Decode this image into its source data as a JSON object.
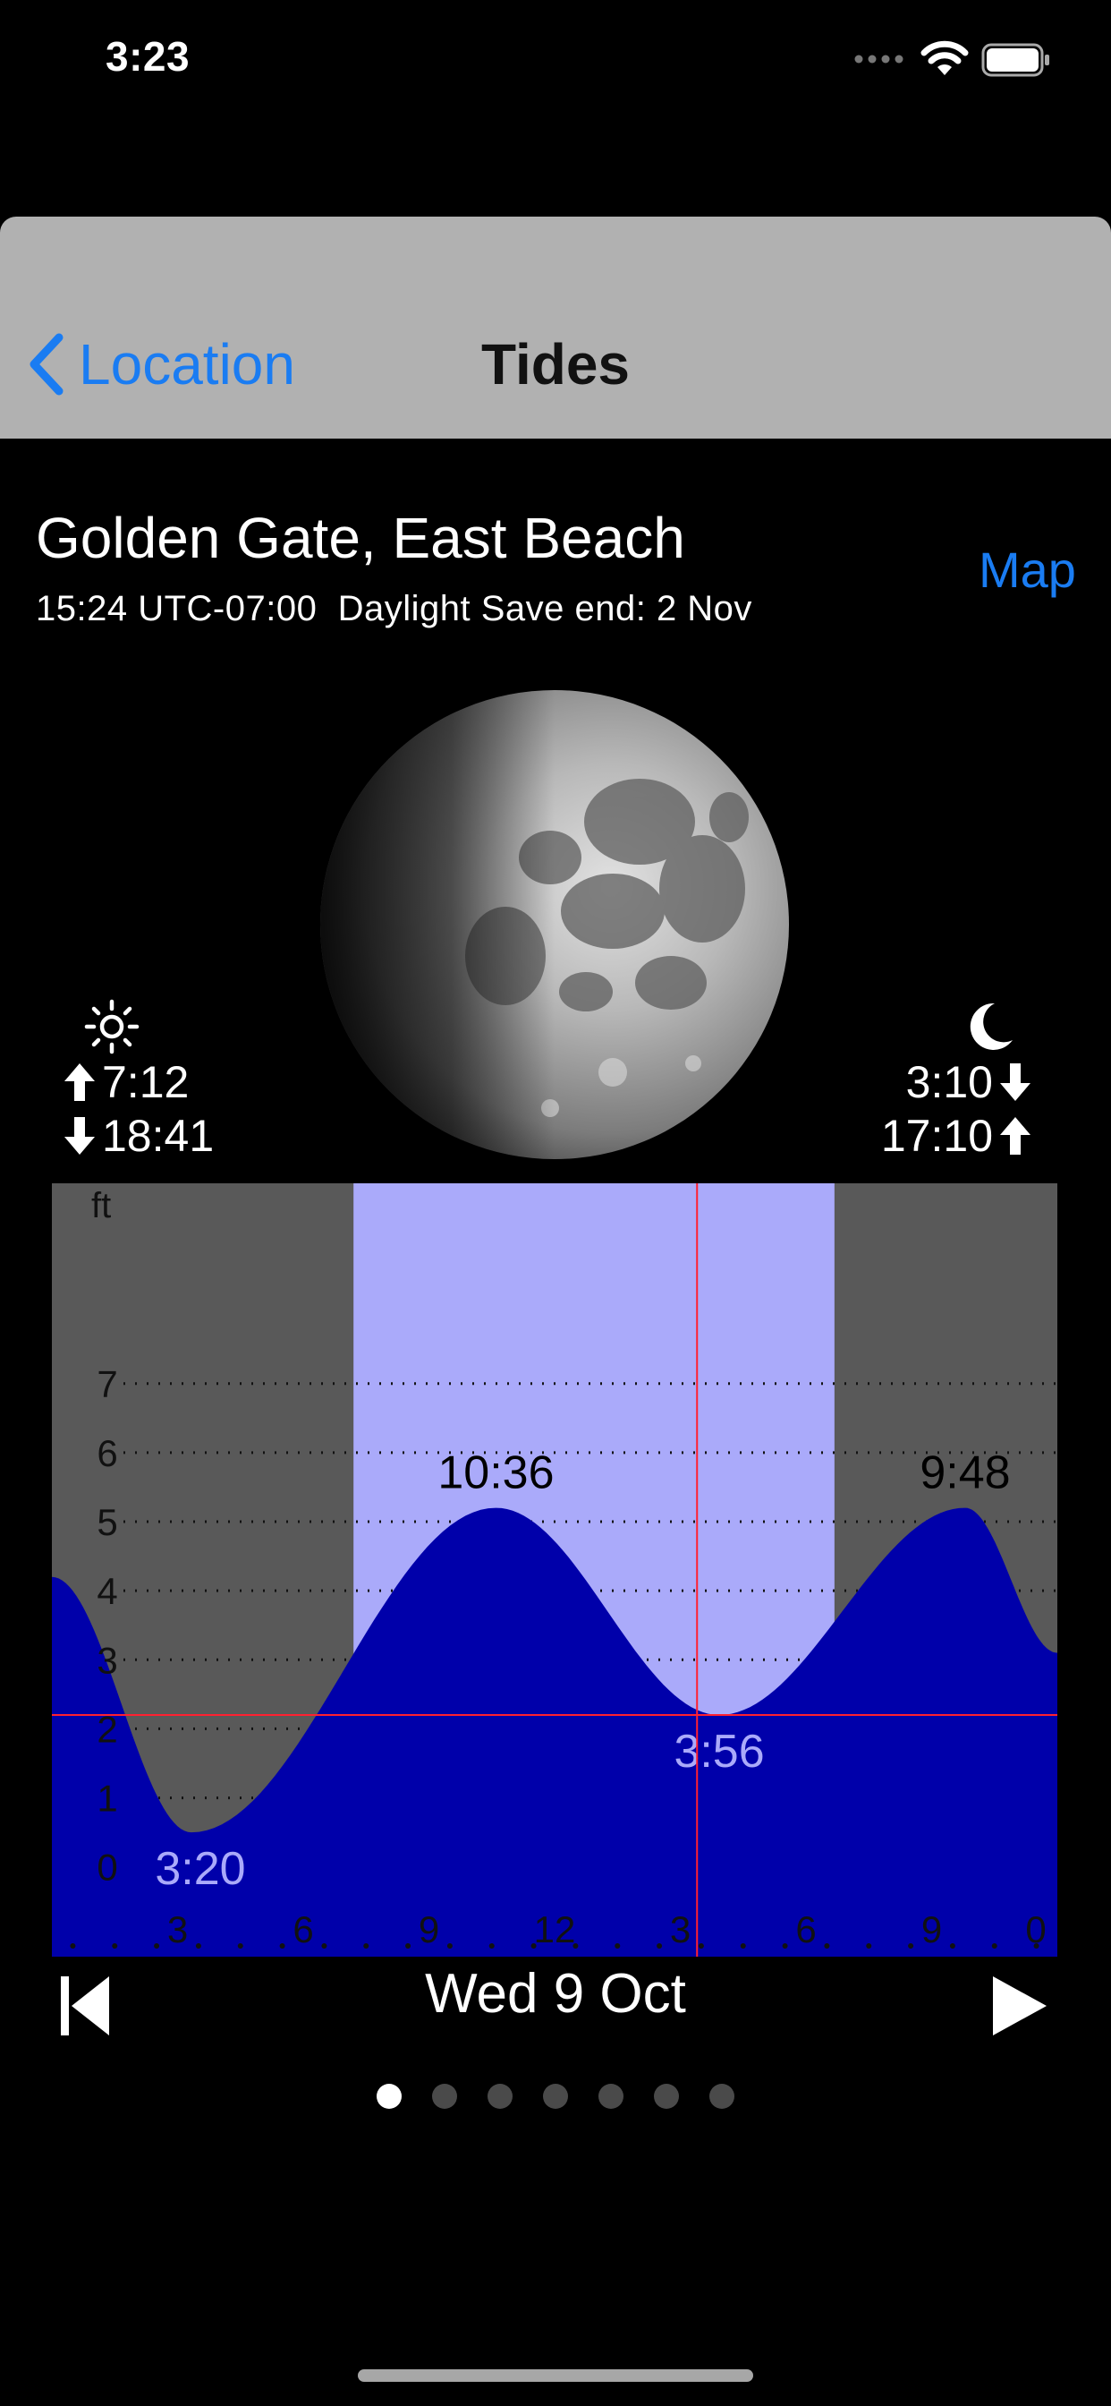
{
  "status_bar": {
    "time": "3:23"
  },
  "nav": {
    "back_label": "Location",
    "title": "Tides"
  },
  "header": {
    "location": "Golden Gate, East Beach",
    "subtitle": "15:24 UTC-07:00  Daylight Save end: 2 Nov",
    "map_link": "Map"
  },
  "sun": {
    "rise": "7:12",
    "set": "18:41"
  },
  "moon": {
    "set": "3:10",
    "rise": "17:10"
  },
  "chart_data": {
    "type": "area",
    "y_unit_label": "ft",
    "y_ticks": [
      "0",
      "1",
      "2",
      "3",
      "4",
      "5",
      "6",
      "7"
    ],
    "ylim": [
      -1.3,
      9.9
    ],
    "x_range_hours": [
      0,
      24
    ],
    "x_ticks": [
      {
        "hour": 3,
        "label": "3"
      },
      {
        "hour": 6,
        "label": "6"
      },
      {
        "hour": 9,
        "label": "9"
      },
      {
        "hour": 12,
        "label": "12"
      },
      {
        "hour": 15,
        "label": "3"
      },
      {
        "hour": 18,
        "label": "6"
      },
      {
        "hour": 21,
        "label": "9"
      },
      {
        "hour": 24,
        "label": "0"
      }
    ],
    "daylight_hours": [
      7.2,
      18.68
    ],
    "current_time_hour": 15.4,
    "current_height_ft": 2.2,
    "series": [
      {
        "x": [
          0,
          3.33,
          10.6,
          15.93,
          21.8,
          24
        ],
        "y": [
          4.2,
          0.5,
          5.2,
          2.2,
          5.2,
          3.1
        ]
      }
    ],
    "extremes": [
      {
        "time": "3:20",
        "hour": 3.33,
        "height": 0.5,
        "type": "low"
      },
      {
        "time": "10:36",
        "hour": 10.6,
        "height": 5.2,
        "type": "high"
      },
      {
        "time": "3:56",
        "hour": 15.93,
        "height": 2.2,
        "type": "low"
      },
      {
        "time": "9:48",
        "hour": 21.8,
        "height": 5.2,
        "type": "high"
      }
    ],
    "colors": {
      "night": "#595959",
      "daylight": "#aaaafa",
      "water": "#0000aa",
      "cursor": "#ff2030",
      "high_label": "#000000",
      "low_label": "#aaaafa"
    }
  },
  "footer": {
    "date": "Wed 9 Oct",
    "pages": 7,
    "active_page": 0
  }
}
